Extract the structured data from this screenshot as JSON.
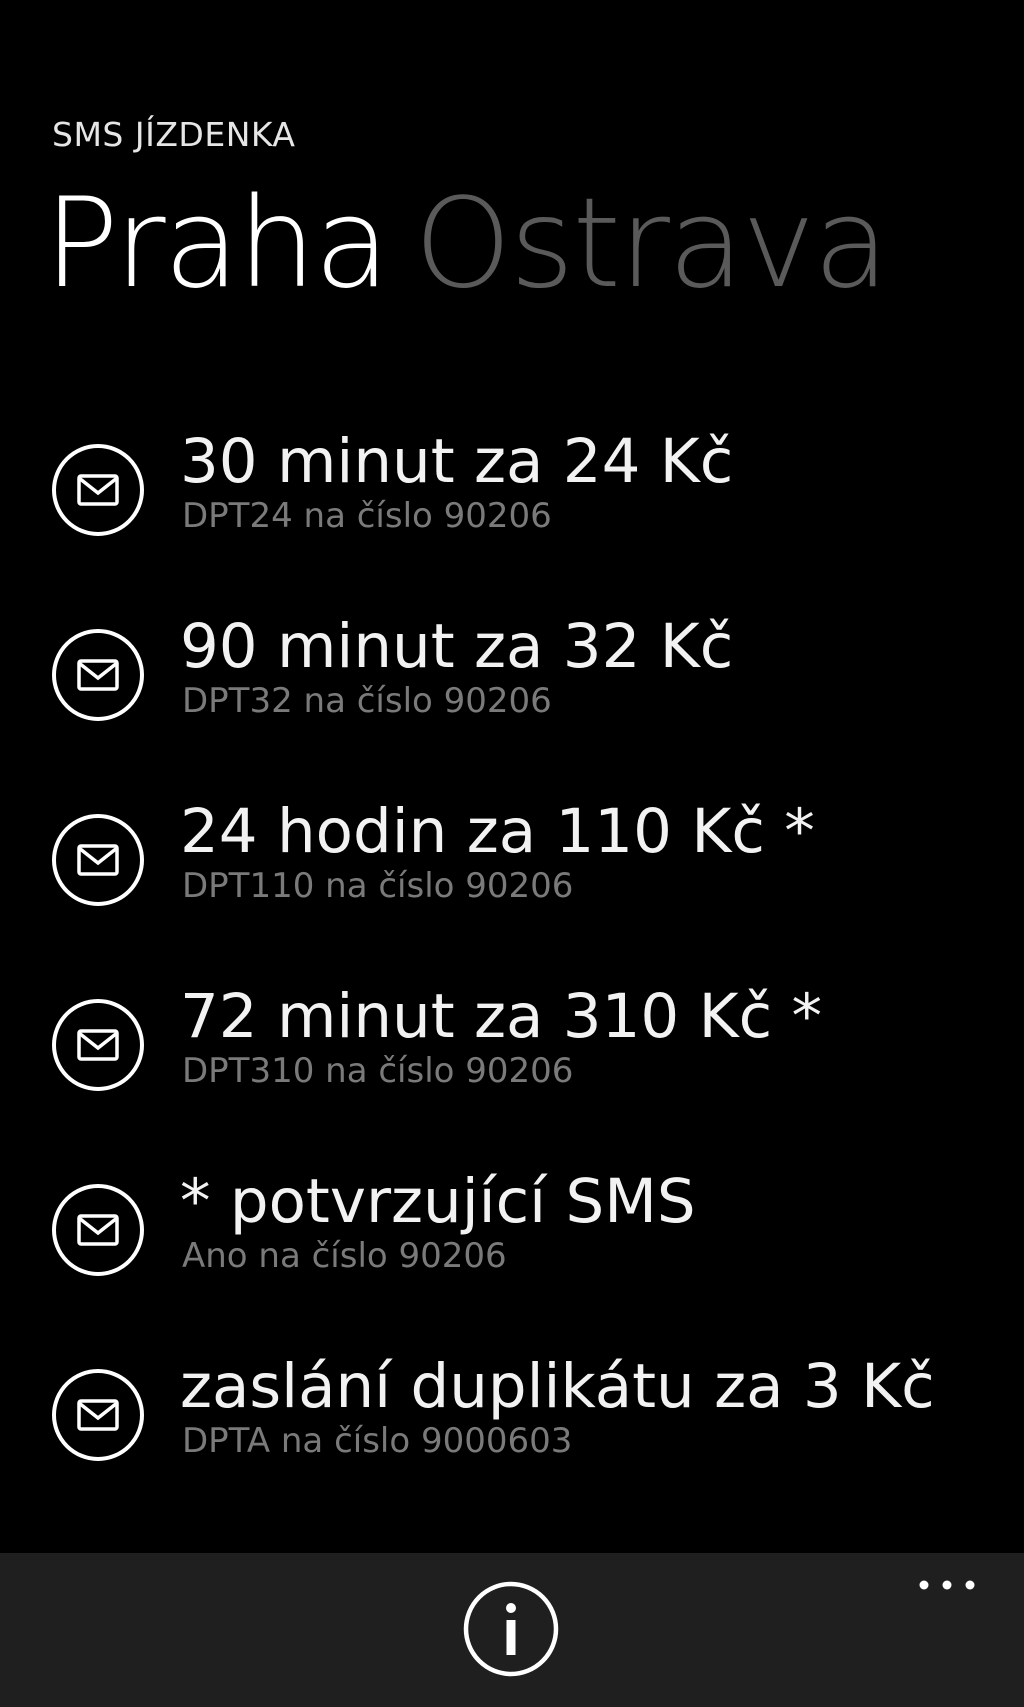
{
  "header": {
    "app_title": "SMS JÍZDENKA",
    "pivot_active": "Praha",
    "pivot_inactive": "Ostrava"
  },
  "items": [
    {
      "title": "30 minut za 24 Kč",
      "subtitle": "DPT24 na číslo 90206",
      "icon": "message-icon"
    },
    {
      "title": "90 minut za 32 Kč",
      "subtitle": "DPT32 na číslo 90206",
      "icon": "message-icon"
    },
    {
      "title": "24 hodin za 110 Kč *",
      "subtitle": "DPT110 na číslo 90206",
      "icon": "message-icon"
    },
    {
      "title": "72 minut za 310 Kč *",
      "subtitle": "DPT310 na číslo 90206",
      "icon": "message-icon"
    },
    {
      "title": "* potvrzující SMS",
      "subtitle": "Ano na číslo 90206",
      "icon": "message-icon"
    },
    {
      "title": "zaslání duplikátu za 3 Kč",
      "subtitle": "DPTA na číslo 9000603",
      "icon": "message-icon"
    }
  ],
  "appbar": {
    "info_icon": "info-icon",
    "more_icon": "more-ellipsis-icon"
  },
  "colors": {
    "background": "#000000",
    "appbar": "#1f1f1f",
    "primary_text": "#ffffff",
    "secondary_text": "#7a7a7a",
    "inactive_pivot": "#5a5a5a"
  }
}
